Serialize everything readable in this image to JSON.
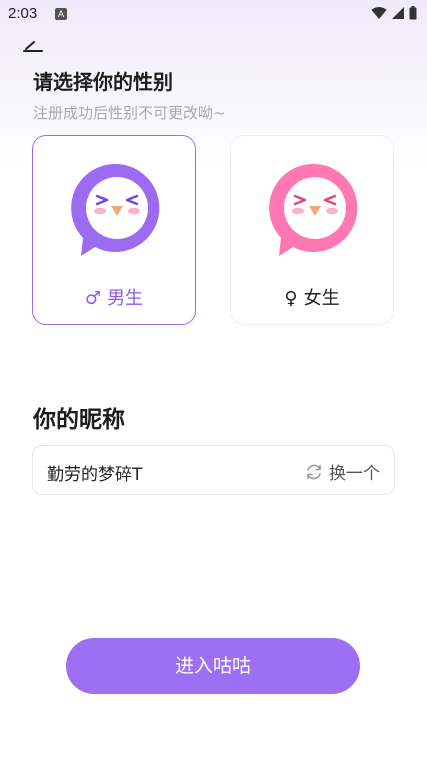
{
  "status_bar": {
    "time": "2:03",
    "notification_icon_letter": "A"
  },
  "header": {
    "title": "请选择你的性别",
    "subtitle": "注册成功后性别不可更改呦~"
  },
  "gender_options": [
    {
      "symbol": "♂",
      "label": "男生",
      "selected": true,
      "color": "#9b6cf2"
    },
    {
      "symbol": "♀",
      "label": "女生",
      "selected": false,
      "color": "#ff78b4"
    }
  ],
  "nickname": {
    "section_title": "你的昵称",
    "value": "勤劳的梦碎T",
    "refresh_label": "换一个",
    "refresh_icon": "refresh-icon"
  },
  "enter_button": {
    "label": "进入咕咕",
    "color": "#9d6ff3"
  }
}
